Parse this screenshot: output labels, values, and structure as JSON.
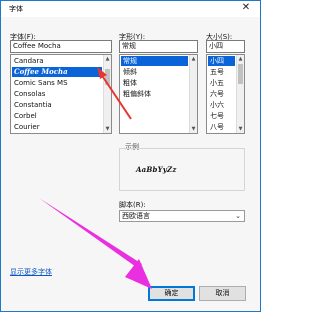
{
  "window": {
    "title": "字体"
  },
  "font_label": "字体(F):",
  "font_input_value": "Coffee Mocha",
  "font_list": [
    {
      "label": "Candara",
      "selected": false
    },
    {
      "label": "Coffee Mocha",
      "selected": true
    },
    {
      "label": "Comic Sans MS",
      "selected": false
    },
    {
      "label": "Consolas",
      "selected": false
    },
    {
      "label": "Constantia",
      "selected": false
    },
    {
      "label": "Corbel",
      "selected": false
    },
    {
      "label": "Courier",
      "selected": false
    }
  ],
  "style_label": "字形(Y):",
  "style_input_value": "常规",
  "style_list": [
    {
      "label": "常规",
      "selected": true
    },
    {
      "label": "倾斜",
      "selected": false
    },
    {
      "label": "粗体",
      "selected": false
    },
    {
      "label": "粗偏斜体",
      "selected": false
    }
  ],
  "size_label": "大小(S):",
  "size_input_value": "小四",
  "size_list": [
    {
      "label": "小四",
      "selected": true
    },
    {
      "label": "五号",
      "selected": false
    },
    {
      "label": "小五",
      "selected": false
    },
    {
      "label": "六号",
      "selected": false
    },
    {
      "label": "小六",
      "selected": false
    },
    {
      "label": "七号",
      "selected": false
    },
    {
      "label": "八号",
      "selected": false
    }
  ],
  "sample_label": "示例",
  "sample_text": "AaBbYyZz",
  "script_label": "脚本(R):",
  "script_value": "西欧语言",
  "show_more_fonts": "显示更多字体",
  "ok_label": "确定",
  "cancel_label": "取消",
  "colors": {
    "accent": "#0a64d8",
    "annotation_arrow": "#e8352f",
    "annotation_arrow2": "#ea2fe0"
  }
}
